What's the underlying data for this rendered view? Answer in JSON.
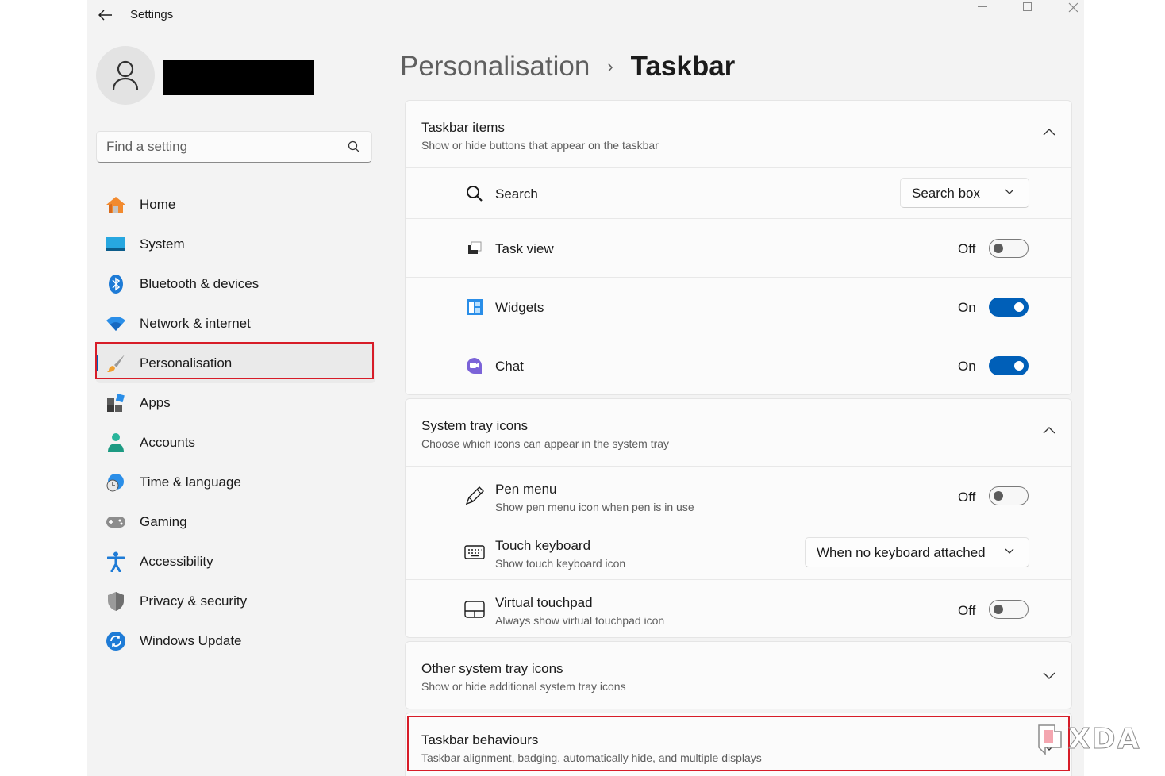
{
  "app": {
    "title": "Settings"
  },
  "search": {
    "placeholder": "Find a setting"
  },
  "nav": {
    "items": [
      {
        "label": "Home",
        "icon": "home-icon"
      },
      {
        "label": "System",
        "icon": "monitor-icon"
      },
      {
        "label": "Bluetooth & devices",
        "icon": "bluetooth-icon"
      },
      {
        "label": "Network & internet",
        "icon": "wifi-icon"
      },
      {
        "label": "Personalisation",
        "icon": "paintbrush-icon",
        "active": true
      },
      {
        "label": "Apps",
        "icon": "apps-icon"
      },
      {
        "label": "Accounts",
        "icon": "person-icon"
      },
      {
        "label": "Time & language",
        "icon": "globe-clock-icon"
      },
      {
        "label": "Gaming",
        "icon": "gamepad-icon"
      },
      {
        "label": "Accessibility",
        "icon": "accessibility-icon"
      },
      {
        "label": "Privacy & security",
        "icon": "shield-icon"
      },
      {
        "label": "Windows Update",
        "icon": "update-icon"
      }
    ]
  },
  "breadcrumb": {
    "parent": "Personalisation",
    "separator": "›",
    "current": "Taskbar"
  },
  "sections": {
    "taskbar_items": {
      "title": "Taskbar items",
      "subtitle": "Show or hide buttons that appear on the taskbar",
      "rows": {
        "search": {
          "label": "Search",
          "value": "Search box"
        },
        "task_view": {
          "label": "Task view",
          "state": "Off"
        },
        "widgets": {
          "label": "Widgets",
          "state": "On"
        },
        "chat": {
          "label": "Chat",
          "state": "On"
        }
      }
    },
    "system_tray": {
      "title": "System tray icons",
      "subtitle": "Choose which icons can appear in the system tray",
      "rows": {
        "pen_menu": {
          "label": "Pen menu",
          "description": "Show pen menu icon when pen is in use",
          "state": "Off"
        },
        "touch_keyboard": {
          "label": "Touch keyboard",
          "description": "Show touch keyboard icon",
          "value": "When no keyboard attached"
        },
        "virtual_touchpad": {
          "label": "Virtual touchpad",
          "description": "Always show virtual touchpad icon",
          "state": "Off"
        }
      }
    },
    "other_tray": {
      "title": "Other system tray icons",
      "subtitle": "Show or hide additional system tray icons"
    },
    "behaviours": {
      "title": "Taskbar behaviours",
      "subtitle": "Taskbar alignment, badging, automatically hide, and multiple displays"
    }
  },
  "watermark": {
    "text": "XDA"
  },
  "colors": {
    "accent": "#005fb8",
    "highlight": "#d71c28"
  }
}
